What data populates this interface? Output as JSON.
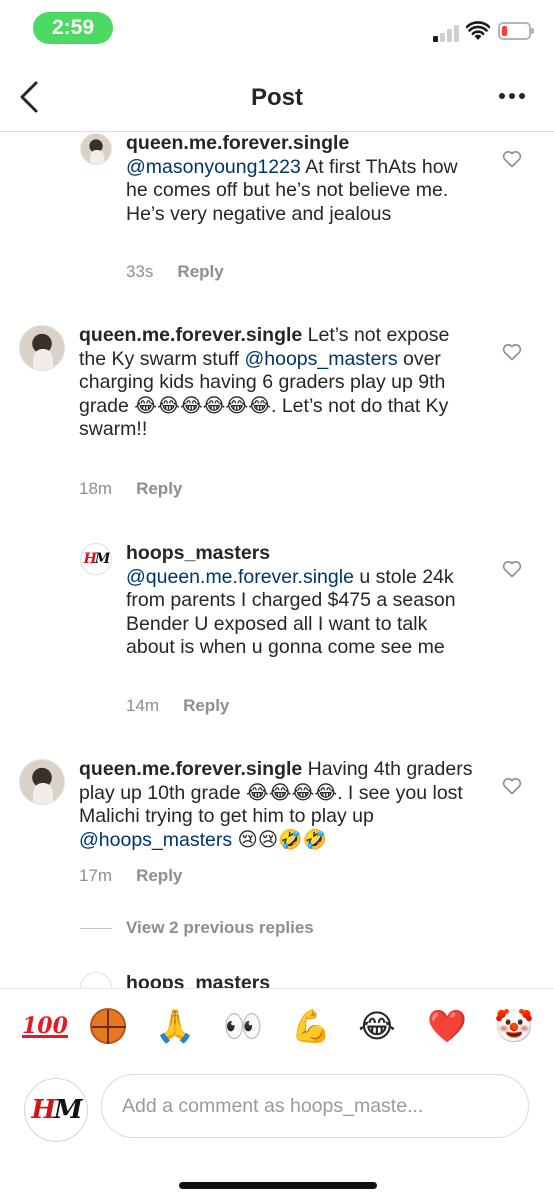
{
  "status_bar": {
    "time": "2:59",
    "battery_color": "#ff3b30",
    "time_pill_color": "#4cd964"
  },
  "header": {
    "title": "Post",
    "back_icon": "chevron-left-icon",
    "more_icon": "more-horizontal-icon"
  },
  "comments": [
    {
      "username": "queen.me.forever.single",
      "mention": "@masonyoung1223",
      "text": " At first ThAts how he comes off but he’s not believe me. He’s very negative and jealous",
      "time": "33s",
      "reply_label": "Reply"
    },
    {
      "username": "queen.me.forever.single",
      "text_before": " Let’s not expose the Ky swarm stuff ",
      "mention": "@hoops_masters",
      "text_after": "  over charging kids having 6 graders play up 9th grade 😂😂😂😂😂😂. Let’s not do that Ky swarm!!",
      "time": "18m",
      "reply_label": "Reply"
    },
    {
      "username": "hoops_masters",
      "mention": "@queen.me.forever.single",
      "text": " u stole 24k from parents I charged $475 a season Bender U exposed all I want to talk about is when u gonna come see me",
      "time": "14m",
      "reply_label": "Reply"
    },
    {
      "username": "queen.me.forever.single",
      "text_before": " Having 4th graders play up 10th grade 😂😂😂😂. I see you lost Malichi trying to get him to play up ",
      "mention": "@hoops_masters",
      "text_after": " 😢😢🤣🤣",
      "time": "17m",
      "reply_label": "Reply"
    }
  ],
  "view_replies": "View 2 previous replies",
  "partial_username": "hoops_masters",
  "emoji_bar": [
    "💯",
    "🏀",
    "🙏",
    "👀",
    "💪",
    "😂",
    "❤️",
    "🤡"
  ],
  "composer": {
    "placeholder": "Add a comment as hoops_maste..."
  },
  "logo": {
    "letters_red": "H",
    "letters_dark": "M"
  }
}
